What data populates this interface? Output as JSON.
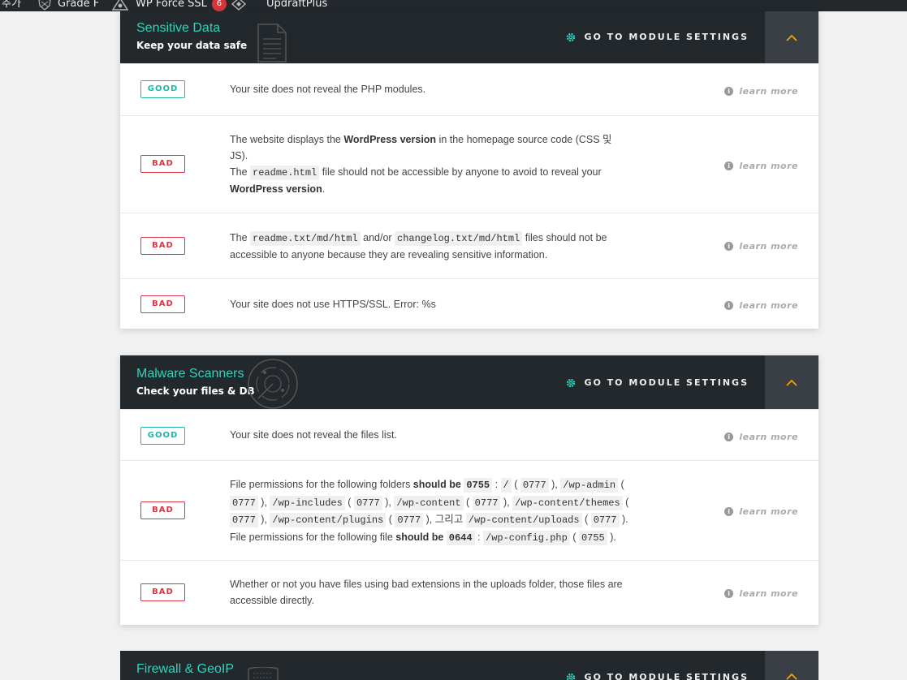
{
  "adminbar": {
    "item_add": "추가",
    "item_grade": "Grade F",
    "item_force_ssl": "WP Force SSL",
    "force_ssl_count": "6",
    "item_updraft": "UpdraftPlus"
  },
  "common": {
    "settings_label": "GO TO MODULE SETTINGS",
    "learn_more": "learn more",
    "good": "GOOD",
    "bad": "BAD",
    "info_glyph": "i"
  },
  "sensitive": {
    "title": "Sensitive Data",
    "subtitle": "Keep your data safe",
    "icon": "document-icon",
    "r1": "Your site does not reveal the PHP modules.",
    "r2": {
      "a": "The website displays the ",
      "b": "WordPress version",
      "c": " in the homepage source code (CSS 및 JS).",
      "d": "The ",
      "e": "readme.html",
      "f": " file should not be accessible by anyone to avoid to reveal your ",
      "g": "WordPress version",
      "h": "."
    },
    "r3": {
      "a": "The ",
      "b": "readme.txt/md/html",
      "c": " and/or ",
      "d": "changelog.txt/md/html",
      "e": " files should not be accessible to anyone because they are revealing sensitive information."
    },
    "r4": "Your site does not use HTTPS/SSL. Error: %s"
  },
  "malware": {
    "title": "Malware Scanners",
    "subtitle": "Check your files & DB",
    "icon": "radar-icon",
    "r1": "Your site does not reveal the files list.",
    "r2": {
      "a": "File permissions for the following folders ",
      "b": "should be",
      "c": "0755",
      "d": "/",
      "e": "0777",
      "f": "/wp-admin",
      "g": "/wp-includes",
      "h": "/wp-content",
      "i": "/wp-content/themes",
      "j": "/wp-content/plugins",
      "k": "그리고",
      "l": "/wp-content/uploads",
      "m": "File permissions for the following file ",
      "n": "should be",
      "o": "0644",
      "p": "/wp-config.php",
      "q": "0755"
    },
    "r3": "Whether or not you have files using bad extensions in the uploads folder, those files are accessible directly."
  },
  "firewall": {
    "title": "Firewall & GeoIP",
    "icon": "shield-flag-icon"
  },
  "colors": {
    "accent": "#2dd4bf",
    "bad": "#dc3545",
    "header_bg": "#23282d",
    "toggle_bg": "#3a3f46",
    "chevron": "#f0a500"
  }
}
